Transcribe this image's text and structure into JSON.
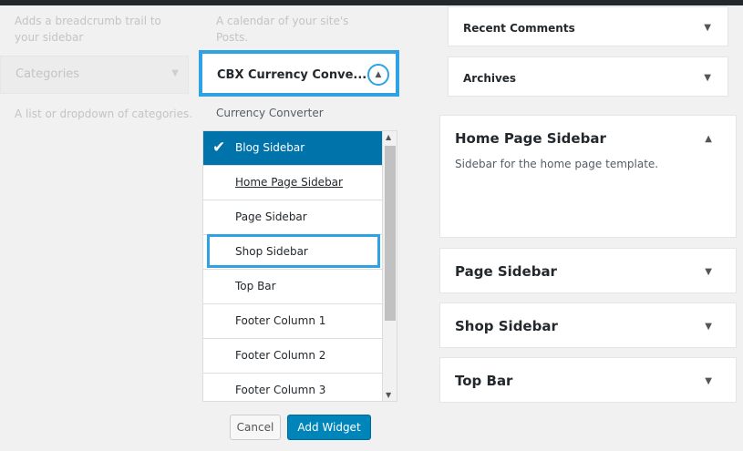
{
  "left": {
    "breadcrumb_desc": "Adds a breadcrumb trail to your sidebar",
    "calendar_desc": "A calendar of your site's Posts.",
    "categories_title": "Categories",
    "categories_desc": "A list or dropdown of categories."
  },
  "widget": {
    "title": "CBX Currency Conve...",
    "subtitle": "Currency Converter"
  },
  "sidebar_list": {
    "items": [
      {
        "label": "Blog Sidebar"
      },
      {
        "label": "Home Page Sidebar"
      },
      {
        "label": "Page Sidebar"
      },
      {
        "label": "Shop Sidebar"
      },
      {
        "label": "Top Bar"
      },
      {
        "label": "Footer Column 1"
      },
      {
        "label": "Footer Column 2"
      },
      {
        "label": "Footer Column 3"
      }
    ],
    "selected": "Blog Sidebar"
  },
  "buttons": {
    "cancel": "Cancel",
    "add_widget": "Add Widget"
  },
  "right": {
    "recent_comments": "Recent Comments",
    "archives": "Archives",
    "home_page_sidebar": "Home Page Sidebar",
    "home_page_sidebar_desc": "Sidebar for the home page template.",
    "page_sidebar": "Page Sidebar",
    "shop_sidebar": "Shop Sidebar",
    "top_bar": "Top Bar"
  }
}
